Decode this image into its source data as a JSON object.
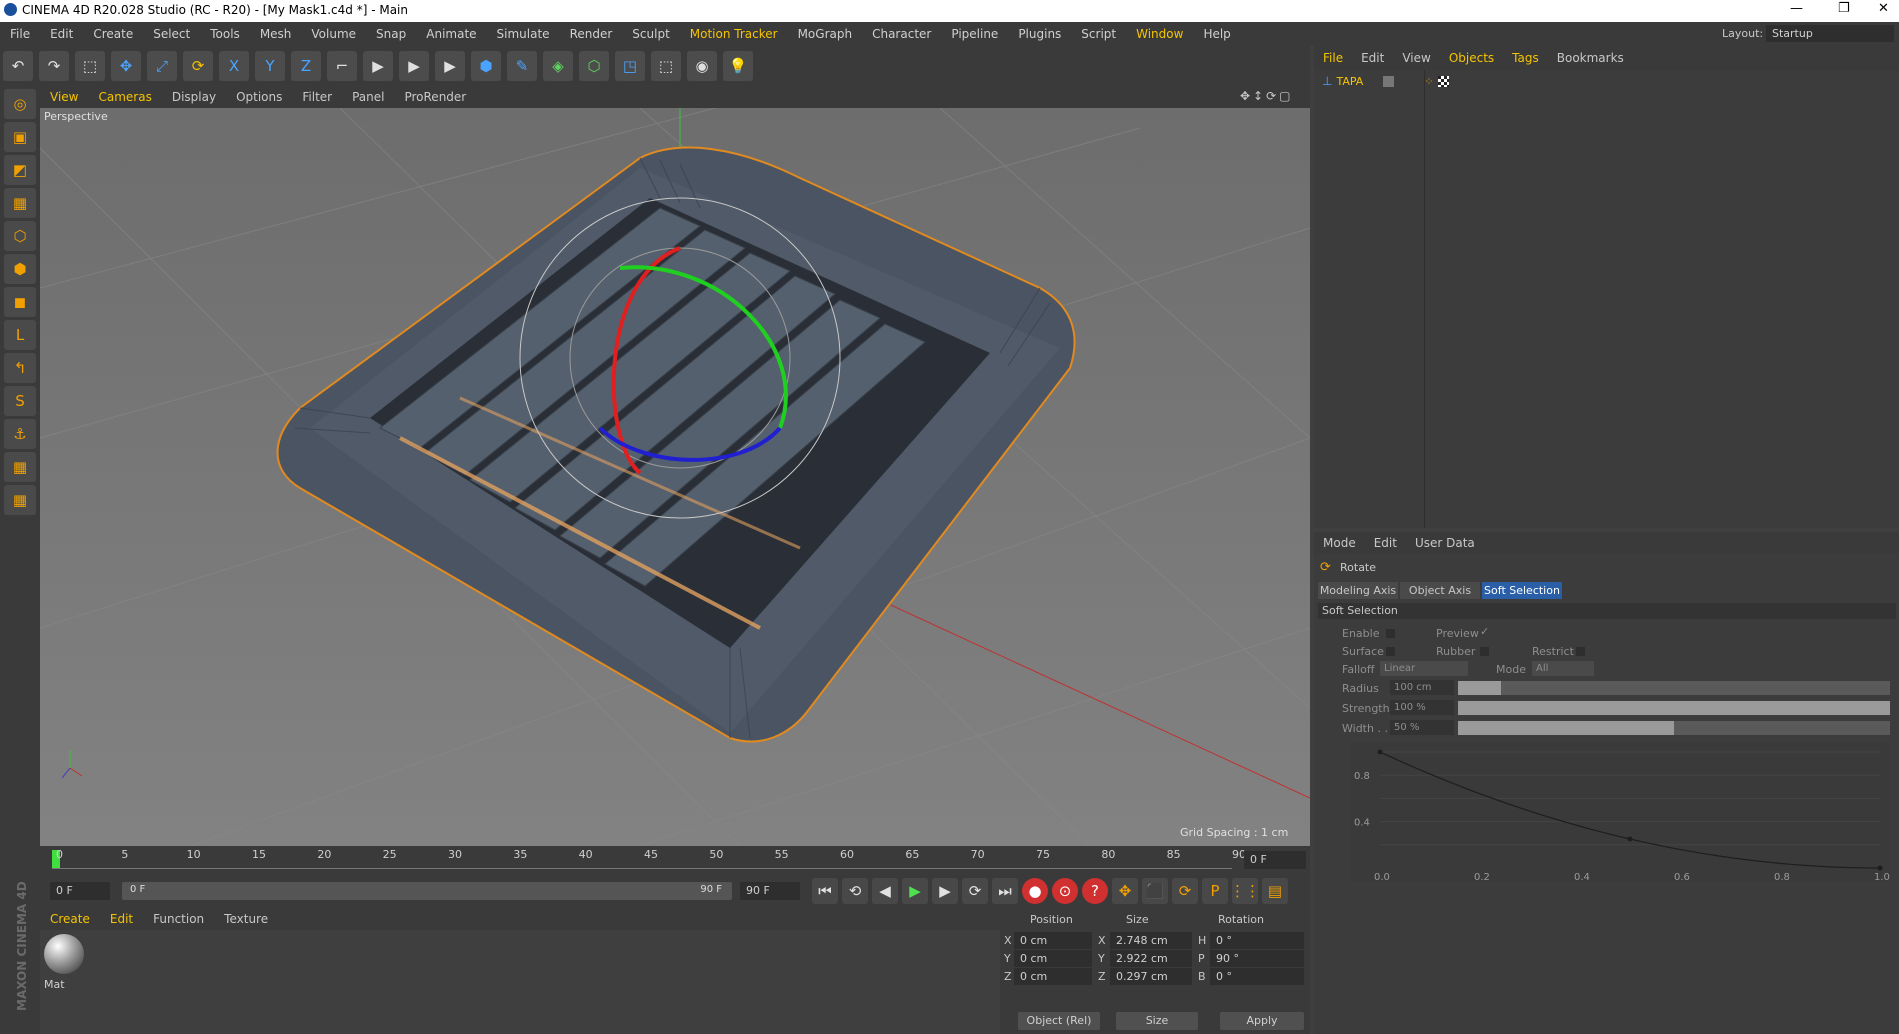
{
  "window": {
    "title": "CINEMA 4D R20.028 Studio (RC - R20) - [My Mask1.c4d *] - Main",
    "controls": [
      "—",
      "❐",
      "✕"
    ]
  },
  "menubar": {
    "items": [
      "File",
      "Edit",
      "Create",
      "Select",
      "Tools",
      "Mesh",
      "Volume",
      "Snap",
      "Animate",
      "Simulate",
      "Render",
      "Sculpt",
      "Motion Tracker",
      "MoGraph",
      "Character",
      "Pipeline",
      "Plugins",
      "Script",
      "Window",
      "Help"
    ],
    "highlight": [
      "Motion Tracker",
      "Window"
    ],
    "layout_label": "Layout:",
    "layout_value": "Startup"
  },
  "toolbar": {
    "icons": [
      "undo-icon",
      "redo-icon",
      "select-icon",
      "move-icon",
      "scale-icon",
      "rotate-icon",
      "x-axis-icon",
      "y-axis-icon",
      "z-axis-icon",
      "coord-system-icon",
      "render-view-icon",
      "render-picture-icon",
      "edit-render-icon",
      "cube-icon",
      "pen-icon",
      "subdivision-icon",
      "array-icon",
      "deformer-icon",
      "scene-icon",
      "camera-icon",
      "light-icon"
    ],
    "glyphs": [
      "↶",
      "↷",
      "⬚",
      "✥",
      "⤢",
      "⟳",
      "X",
      "Y",
      "Z",
      "⌐",
      "▶",
      "▶",
      "▶",
      "⬢",
      "✎",
      "◈",
      "⬡",
      "◳",
      "⬚",
      "◉",
      "💡"
    ]
  },
  "left_toolbar": {
    "icons": [
      "make-editable-icon",
      "model-mode-icon",
      "texture-mode-icon",
      "workplane-icon",
      "points-icon",
      "edges-icon",
      "polygons-icon",
      "axis-icon",
      "tweak-icon",
      "solo-icon",
      "snap-icon",
      "lock-workplane-icon",
      "quantize-icon"
    ],
    "glyphs": [
      "◎",
      "▣",
      "◩",
      "▦",
      "⬡",
      "⬢",
      "◼",
      "L",
      "↰",
      "S",
      "⚓",
      "▦",
      "▦"
    ]
  },
  "viewport": {
    "menu": [
      "View",
      "Cameras",
      "Display",
      "Options",
      "Filter",
      "Panel",
      "ProRender"
    ],
    "highlight": [
      "View",
      "Cameras"
    ],
    "label": "Perspective",
    "grid_spacing": "Grid Spacing : 1 cm"
  },
  "timeline": {
    "ticks": [
      "0",
      "5",
      "10",
      "15",
      "20",
      "25",
      "30",
      "35",
      "40",
      "45",
      "50",
      "55",
      "60",
      "65",
      "70",
      "75",
      "80",
      "85",
      "90"
    ],
    "current_frame": "0 F"
  },
  "transport": {
    "start": "0 F",
    "range_start": "0 F",
    "range_end": "90 F",
    "end": "90 F",
    "glyphs": [
      "⏮",
      "⟲",
      "◀",
      "▶",
      "▶",
      "⟳",
      "⏭",
      "●",
      "⊙",
      "?",
      "✥",
      "⬛",
      "⟳",
      "P",
      "⋮⋮",
      "▤"
    ]
  },
  "materials": {
    "menu": [
      "Create",
      "Edit",
      "Function",
      "Texture"
    ],
    "highlight": [
      "Create",
      "Edit"
    ],
    "items": [
      {
        "name": "Mat"
      }
    ],
    "brand": "MAXON CINEMA 4D"
  },
  "coords": {
    "headers": [
      "Position",
      "Size",
      "Rotation"
    ],
    "rows": [
      {
        "axis": "X",
        "pos": "0 cm",
        "size_axis": "X",
        "size": "2.748 cm",
        "rot_axis": "H",
        "rot": "0 °"
      },
      {
        "axis": "Y",
        "pos": "0 cm",
        "size_axis": "Y",
        "size": "2.922 cm",
        "rot_axis": "P",
        "rot": "90 °"
      },
      {
        "axis": "Z",
        "pos": "0 cm",
        "size_axis": "Z",
        "size": "0.297 cm",
        "rot_axis": "B",
        "rot": "0 °"
      }
    ],
    "mode": "Object (Rel)",
    "size_mode": "Size",
    "apply": "Apply"
  },
  "object_manager": {
    "menu": [
      "File",
      "Edit",
      "View",
      "Objects",
      "Tags",
      "Bookmarks"
    ],
    "highlight": [
      "File",
      "Objects",
      "Tags"
    ],
    "object_name": "TAPA"
  },
  "attribute_manager": {
    "menu": [
      "Mode",
      "Edit",
      "User Data"
    ],
    "tool": "Rotate",
    "tabs": [
      "Modeling Axis",
      "Object Axis",
      "Soft Selection"
    ],
    "active_tab": "Soft Selection",
    "section": "Soft Selection",
    "fields": {
      "enable": "Enable",
      "preview": "Preview",
      "surface": "Surface",
      "rubber": "Rubber",
      "restrict": "Restrict",
      "falloff": "Falloff",
      "falloff_value": "Linear",
      "mode": "Mode",
      "mode_value": "All",
      "radius": "Radius",
      "radius_value": "100 cm",
      "strength": "Strength",
      "strength_value": "100 %",
      "width": "Width . .",
      "width_value": "50 %"
    },
    "levels": {
      "radius": 0.1,
      "strength": 1.0,
      "width": 0.5
    },
    "graph": {
      "y_labels": [
        "0.8",
        "0.4"
      ],
      "x_labels": [
        "0.0",
        "0.2",
        "0.4",
        "0.6",
        "0.8",
        "1.0"
      ],
      "points": [
        [
          0,
          1
        ],
        [
          0.5,
          0.25
        ],
        [
          1,
          0
        ]
      ]
    }
  },
  "colors": {
    "accent": "#f5c400",
    "selection": "#f0a000",
    "active_tab": "#2a5fa8"
  }
}
